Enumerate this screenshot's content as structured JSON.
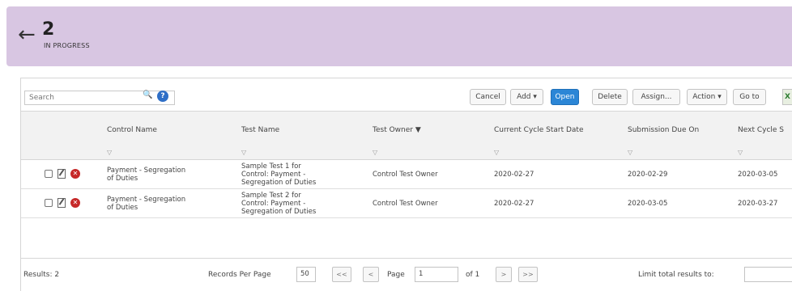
{
  "header": {
    "back_icon": "arrow-left-icon",
    "count": "2",
    "status": "IN PROGRESS"
  },
  "toolbar": {
    "search_placeholder": "Search",
    "help_label": "?",
    "buttons": [
      {
        "label": "Cancel"
      },
      {
        "label": "Add ▾"
      },
      {
        "label": "Open"
      },
      {
        "label": "Delete"
      },
      {
        "label": "Assign..."
      },
      {
        "label": "Action ▾"
      },
      {
        "label": "Go to"
      }
    ],
    "excel_label": "X"
  },
  "table": {
    "columns": [
      "Control Name",
      "Test Name",
      "Test Owner ▼",
      "Current Cycle Start Date",
      "Submission Due On",
      "Next Cycle S"
    ],
    "filter_glyph": "▽",
    "rows": [
      {
        "control_name": [
          "Payment - Segregation",
          "of Duties"
        ],
        "test_name": [
          "Sample Test 1 for",
          "Control: Payment -",
          "Segregation of Duties"
        ],
        "test_owner": "Control Test Owner",
        "start_date": "2020-02-27",
        "due_on": "2020-02-29",
        "next_cycle": "2020-03-05"
      },
      {
        "control_name": [
          "Payment - Segregation",
          "of Duties"
        ],
        "test_name": [
          "Sample Test 2 for",
          "Control: Payment -",
          "Segregation of Duties"
        ],
        "test_owner": "Control Test Owner",
        "start_date": "2020-02-27",
        "due_on": "2020-03-05",
        "next_cycle": "2020-03-27"
      }
    ]
  },
  "footer": {
    "results": "Results: 2",
    "records_per_page_label": "Records Per Page",
    "records_per_page": "50",
    "first": "<<",
    "prev": "<",
    "page_label": "Page",
    "page": "1",
    "of_label": "of 1",
    "next": ">",
    "last": ">>",
    "limit_label": "Limit total results to:"
  },
  "colors": {
    "header_bg": "#d8c6e2",
    "primary_button": "#2b86d6",
    "delete_icon": "#c62828"
  }
}
